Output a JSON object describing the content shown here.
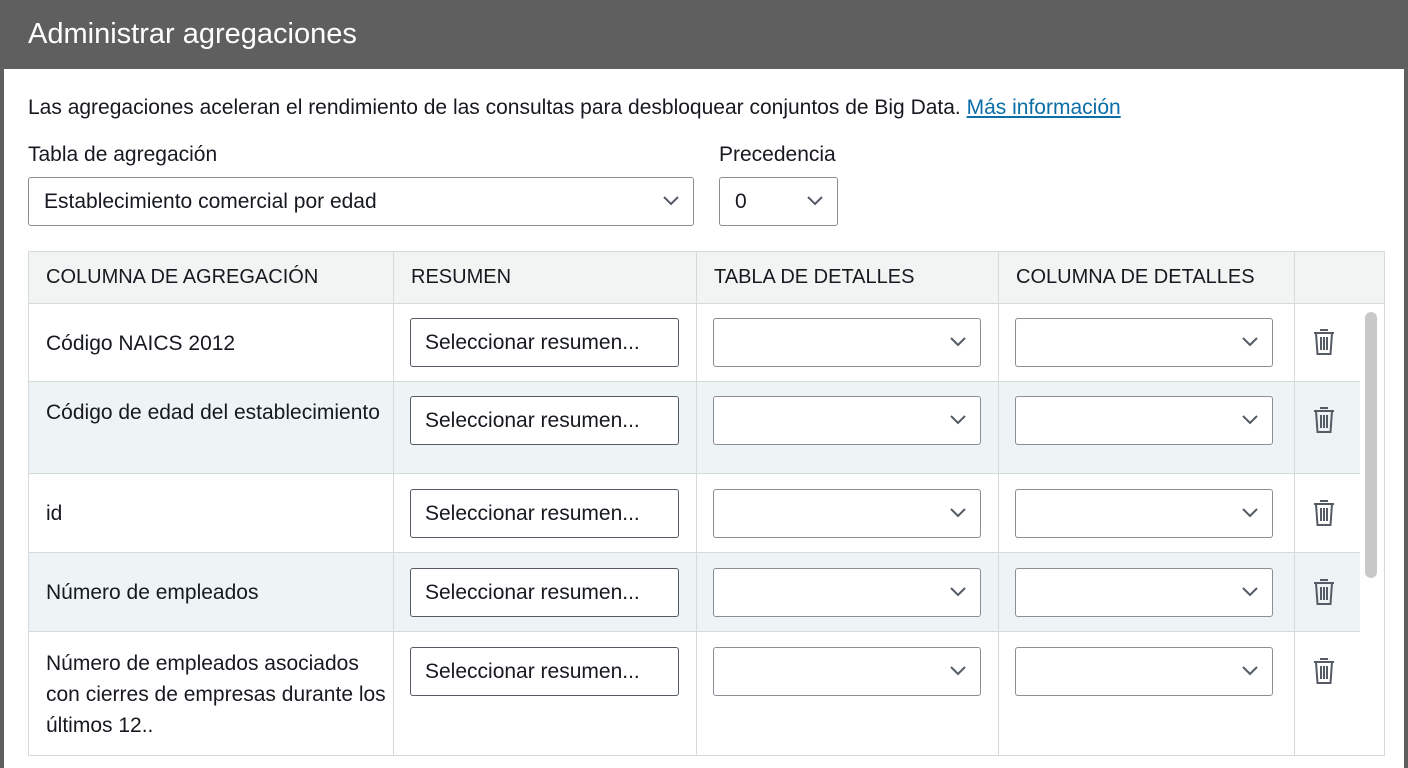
{
  "dialog": {
    "title": "Administrar agregaciones",
    "description": "Las agregaciones aceleran el rendimiento de las consultas para desbloquear conjuntos de Big Data.",
    "learn_more": "Más información"
  },
  "form": {
    "aggregation_table_label": "Tabla de agregación",
    "aggregation_table_value": "Establecimiento comercial por edad",
    "precedence_label": "Precedencia",
    "precedence_value": "0"
  },
  "table": {
    "headers": [
      "COLUMNA DE AGREGACIÓN",
      "RESUMEN",
      "TABLA DE DETALLES",
      "COLUMNA DE DETALLES"
    ],
    "rows": [
      {
        "column": "Código NAICS 2012",
        "summary": "Seleccionar resumen...",
        "detail_table": "",
        "detail_column": ""
      },
      {
        "column": "Código de edad del establecimiento",
        "summary": "Seleccionar resumen...",
        "detail_table": "",
        "detail_column": ""
      },
      {
        "column": "id",
        "summary": "Seleccionar resumen...",
        "detail_table": "",
        "detail_column": ""
      },
      {
        "column": "Número de empleados",
        "summary": "Seleccionar resumen...",
        "detail_table": "",
        "detail_column": ""
      },
      {
        "column": "Número de empleados asociados con cierres de empresas durante los últimos 12..",
        "summary": "Seleccionar resumen...",
        "detail_table": "",
        "detail_column": ""
      }
    ]
  },
  "icons": {
    "dropdown": "chevron-down-icon",
    "delete": "trash-icon"
  },
  "colors": {
    "title_bar": "#5f5f5f",
    "link": "#0b6ea7",
    "header_bg": "#f2f3f3",
    "alt_row_bg": "#eef3f6"
  }
}
